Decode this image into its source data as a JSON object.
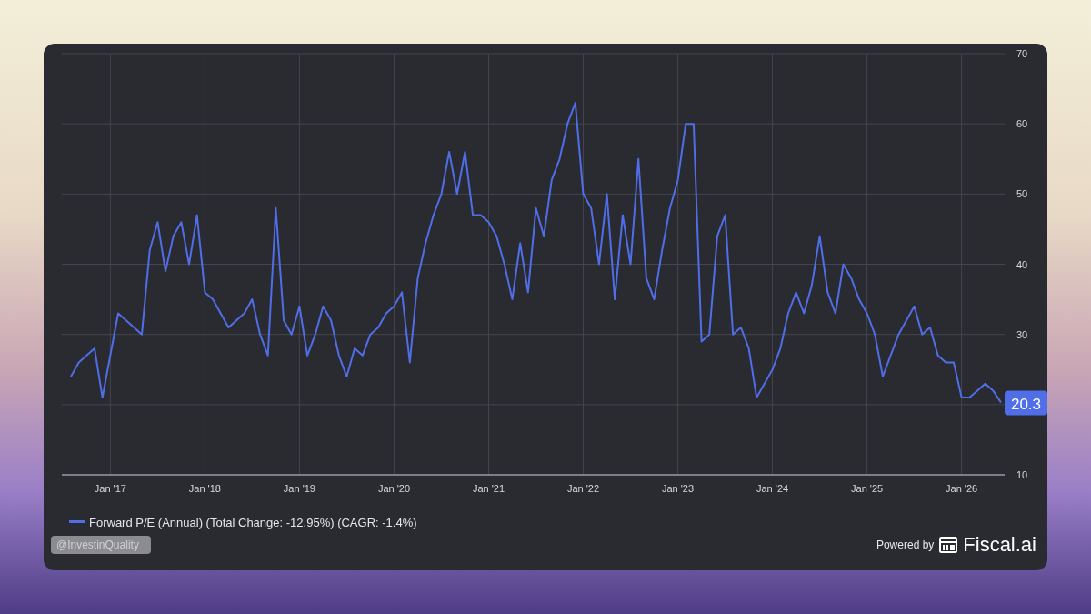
{
  "chart": {
    "chart_data": {
      "type": "line",
      "ylim": [
        10,
        70
      ],
      "grid": true,
      "yticks": [
        10,
        30,
        40,
        50,
        60,
        70
      ],
      "categories": [
        null,
        null,
        null,
        null,
        null,
        "Jan '17",
        null,
        null,
        null,
        null,
        null,
        null,
        null,
        null,
        null,
        null,
        null,
        "Jan '18",
        null,
        null,
        null,
        null,
        null,
        null,
        null,
        null,
        null,
        null,
        null,
        "Jan '19",
        null,
        null,
        null,
        null,
        null,
        null,
        null,
        null,
        null,
        null,
        null,
        "Jan '20",
        null,
        null,
        null,
        null,
        null,
        null,
        null,
        null,
        null,
        null,
        null,
        "Jan '21",
        null,
        null,
        null,
        null,
        null,
        null,
        null,
        null,
        null,
        null,
        null,
        "Jan '22",
        null,
        null,
        null,
        null,
        null,
        null,
        null,
        null,
        null,
        null,
        null,
        "Jan '23",
        null,
        null,
        null,
        null,
        null,
        null,
        null,
        null,
        null,
        null,
        null,
        "Jan '24",
        null,
        null,
        null,
        null,
        null,
        null,
        null,
        null,
        null,
        null,
        null,
        "Jan '25",
        null,
        null,
        null,
        null,
        null,
        null,
        null,
        null,
        null,
        null,
        null,
        "Jan '26",
        null,
        null,
        null,
        null,
        null
      ],
      "series": [
        {
          "name": "Forward P/E (Annual) (Total Change: -12.95%) (CAGR: -1.4%)",
          "color": "#4f6ee8",
          "values": [
            24,
            26,
            27,
            28,
            21,
            27,
            33,
            32,
            31,
            30,
            42,
            46,
            39,
            44,
            46,
            40,
            47,
            36,
            35,
            33,
            31,
            32,
            33,
            35,
            30,
            27,
            48,
            32,
            30,
            34,
            27,
            30,
            34,
            32,
            27,
            24,
            28,
            27,
            30,
            31,
            33,
            34,
            36,
            26,
            38,
            43,
            47,
            50,
            56,
            50,
            56,
            47,
            47,
            46,
            44,
            40,
            35,
            43,
            36,
            48,
            44,
            52,
            55,
            60,
            63,
            50,
            48,
            40,
            50,
            35,
            47,
            40,
            55,
            38,
            35,
            42,
            48,
            52,
            60,
            60,
            29,
            30,
            44,
            47,
            30,
            31,
            28,
            21,
            23,
            25,
            28,
            33,
            36,
            33,
            37,
            44,
            36,
            33,
            40,
            38,
            35,
            33,
            30,
            24,
            27,
            30,
            32,
            34,
            30,
            31,
            27,
            26,
            26,
            21,
            21,
            22,
            23,
            22,
            20.3
          ]
        }
      ]
    },
    "current_value": "20.3"
  },
  "watermark": "@InvestinQuality",
  "footer": {
    "powered_by": "Powered by",
    "brand": "Fiscal.ai"
  }
}
